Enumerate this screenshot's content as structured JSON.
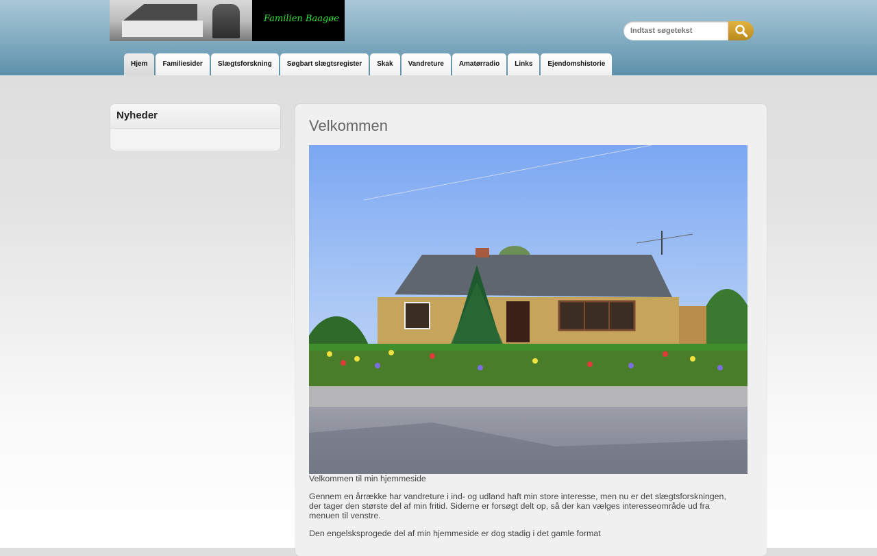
{
  "header": {
    "logo_text": "Familien Baagøe",
    "search": {
      "placeholder": "Indtast søgetekst",
      "button_icon": "magnifier-icon"
    }
  },
  "nav": {
    "tabs": [
      {
        "label": "Hjem",
        "active": true
      },
      {
        "label": "Familiesider"
      },
      {
        "label": "Slægtsforskning"
      },
      {
        "label": "Søgbart slægtsregister"
      },
      {
        "label": "Skak"
      },
      {
        "label": "Vandreture"
      },
      {
        "label": "Amatørradio"
      },
      {
        "label": "Links"
      },
      {
        "label": "Ejendomshistorie"
      }
    ]
  },
  "sidebar": {
    "title": "Nyheder"
  },
  "main": {
    "title": "Velkommen",
    "caption": "Velkommen til min hjemmeside",
    "paragraph1": "Gennem en årrække har vandreture i ind- og udland haft min store interesse, men nu er det slægtsforskningen, der tager den største del af min fritid. Siderne er forsøgt delt op, så der kan vælges interesseområde ud fra menuen til venstre.",
    "paragraph2": "Den engelsksprogede del af min hjemmeside er dog stadig i det gamle format"
  },
  "colors": {
    "header_top": "#a9c8d7",
    "header_bottom": "#5d90aa",
    "logo_text": "#32e03c",
    "search_button": "#d1a12d"
  }
}
